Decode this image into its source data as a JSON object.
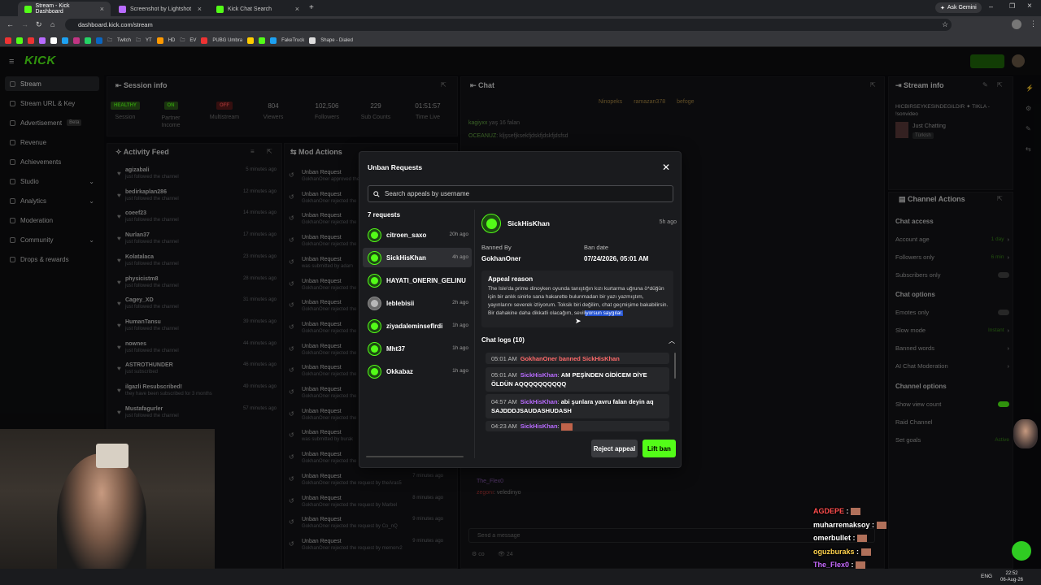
{
  "browser": {
    "tabs": [
      {
        "label": "Stream - Kick Dashboard",
        "active": true
      },
      {
        "label": "Screenshot by Lightshot",
        "active": false
      },
      {
        "label": "Kick Chat Search",
        "active": false
      }
    ],
    "ask_gemini": "Ask Gemini",
    "url": "dashboard.kick.com/stream",
    "bookmarks": [
      "Twitch",
      "YT",
      "HD",
      "EV",
      "PUBG Umbra",
      "FakeTruck",
      "Shape - Dialed"
    ]
  },
  "app": {
    "logo": "KICK",
    "sidebar": [
      {
        "label": "Stream",
        "active": true
      },
      {
        "label": "Stream URL & Key"
      },
      {
        "label": "Advertisement",
        "badge": "Beta"
      },
      {
        "label": "Revenue"
      },
      {
        "label": "Achievements"
      },
      {
        "label": "Studio"
      },
      {
        "label": "Analytics"
      },
      {
        "label": "Moderation"
      },
      {
        "label": "Community"
      },
      {
        "label": "Drops & rewards"
      }
    ],
    "session_info": {
      "title": "Session info",
      "stats": [
        {
          "value": "HEALTHY",
          "label": "Session"
        },
        {
          "value": "ON",
          "label": "Partner Income"
        },
        {
          "value": "OFF",
          "label": "Multistream"
        },
        {
          "value": "804",
          "label": "Viewers"
        },
        {
          "value": "102,506",
          "label": "Followers"
        },
        {
          "value": "229",
          "label": "Sub Counts"
        },
        {
          "value": "01:51:57",
          "label": "Time Live"
        }
      ]
    },
    "activity_feed": {
      "title": "Activity Feed",
      "items": [
        {
          "name": "agizabali",
          "sub": "just followed the channel",
          "time": "5 minutes ago"
        },
        {
          "name": "bedirkaplan286",
          "sub": "just followed the channel",
          "time": "12 minutes ago"
        },
        {
          "name": "coeef23",
          "sub": "just followed the channel",
          "time": "14 minutes ago"
        },
        {
          "name": "Nurlan37",
          "sub": "just followed the channel",
          "time": "17 minutes ago"
        },
        {
          "name": "Kolatalaca",
          "sub": "just followed the channel",
          "time": "23 minutes ago"
        },
        {
          "name": "physicistm8",
          "sub": "just followed the channel",
          "time": "28 minutes ago"
        },
        {
          "name": "Cagey_XD",
          "sub": "just followed the channel",
          "time": "31 minutes ago"
        },
        {
          "name": "HumanTansu",
          "sub": "just followed the channel",
          "time": "39 minutes ago"
        },
        {
          "name": "nownes",
          "sub": "just followed the channel",
          "time": "44 minutes ago"
        },
        {
          "name": "ASTROTHUNDER",
          "sub": "just subscribed",
          "time": "46 minutes ago"
        },
        {
          "name": "ilgazli Resubscribed!",
          "sub": "they have been subscribed for 3 months",
          "time": "49 minutes ago"
        },
        {
          "name": "Mustafagurler",
          "sub": "just followed the channel",
          "time": "57 minutes ago"
        }
      ]
    },
    "mod_actions": {
      "title": "Mod Actions",
      "items": [
        {
          "title": "Unban Request",
          "sub": "GokhanOner approved the"
        },
        {
          "title": "Unban Request",
          "sub": "GokhanOner rejected the"
        },
        {
          "title": "Unban Request",
          "sub": "GokhanOner rejected the"
        },
        {
          "title": "Unban Request",
          "sub": "GokhanOner rejected the"
        },
        {
          "title": "Unban Request",
          "sub": "was submitted by adam"
        },
        {
          "title": "Unban Request",
          "sub": "GokhanOner rejected the"
        },
        {
          "title": "Unban Request",
          "sub": "GokhanOner rejected the"
        },
        {
          "title": "Unban Request",
          "sub": "GokhanOner rejected the"
        },
        {
          "title": "Unban Request",
          "sub": "GokhanOner rejected the"
        },
        {
          "title": "Unban Request",
          "sub": "GokhanOner rejected the"
        },
        {
          "title": "Unban Request",
          "sub": "GokhanOner rejected the"
        },
        {
          "title": "Unban Request",
          "sub": "GokhanOner rejected the"
        },
        {
          "title": "Unban Request",
          "sub": "was submitted by burak"
        },
        {
          "title": "Unban Request",
          "sub": "GokhanOner rejected the"
        },
        {
          "title": "Unban Request",
          "sub": "GokhanOner rejected the request by theAras5",
          "time": "7 minutes ago"
        },
        {
          "title": "Unban Request",
          "sub": "GokhanOner rejected the request by Marbel",
          "time": "8 minutes ago"
        },
        {
          "title": "Unban Request",
          "sub": "GokhanOner rejected the request by Co_nQ",
          "time": "9 minutes ago"
        },
        {
          "title": "Unban Request",
          "sub": "GokhanOner rejected the request by memorv2",
          "time": "9 minutes ago"
        }
      ]
    },
    "chat": {
      "title": "Chat",
      "pinned": [
        "Ninopeks",
        "ramazan378",
        "befoge"
      ],
      "lines": [
        {
          "user": "kagiyxx",
          "msg": "yaş 16 falan"
        },
        {
          "user": "OCEANUZ",
          "msg": "kljşsefjksekfjdskfjdskfjdsfsd"
        },
        {
          "user": "AGDEPE",
          "msg": ""
        },
        {
          "user": "The_Flex0",
          "msg": ""
        },
        {
          "user": "zegonı",
          "msg": "veledinyo"
        }
      ],
      "input_placeholder": "Send a message",
      "viewer_count": "24"
    },
    "stream_info": {
      "title": "Stream info",
      "stream_title": "HICBIRSEYKESINDEGILDIR ✦ TIKLA - !sonvideo",
      "category": "Just Chatting",
      "language": "Türkish"
    },
    "channel_actions": {
      "title": "Channel Actions",
      "sections": [
        {
          "heading": "Chat access",
          "items": [
            {
              "label": "Account age",
              "value": "1 day"
            },
            {
              "label": "Followers only",
              "value": "6 min"
            },
            {
              "label": "Subscribers only",
              "value": "toggle-off"
            }
          ]
        },
        {
          "heading": "Chat options",
          "items": [
            {
              "label": "Emotes only",
              "value": "toggle-off"
            },
            {
              "label": "Slow mode",
              "value": "Instant"
            },
            {
              "label": "Banned words",
              "value": ""
            },
            {
              "label": "AI Chat Moderation",
              "value": ""
            }
          ]
        },
        {
          "heading": "Channel options",
          "items": [
            {
              "label": "Show view count",
              "value": "toggle-on"
            },
            {
              "label": "Raid Channel",
              "value": ""
            },
            {
              "label": "Set goals",
              "value": "Active"
            }
          ]
        }
      ]
    }
  },
  "modal": {
    "title": "Unban Requests",
    "search_placeholder": "Search appeals by username",
    "count_label": "7 requests",
    "requests": [
      {
        "name": "citroen_saxo",
        "time": "20h ago",
        "avatar": "kick"
      },
      {
        "name": "SickHisKhan",
        "time": "4h ago",
        "avatar": "kick",
        "selected": true
      },
      {
        "name": "HAYATI_ONERIN_GELINU",
        "time": "",
        "avatar": "kick"
      },
      {
        "name": "leblebisii",
        "time": "2h ago",
        "avatar": "photo"
      },
      {
        "name": "ziyadaleminseflrdir",
        "time": "1h ago",
        "avatar": "kick"
      },
      {
        "name": "Mht37",
        "time": "1h ago",
        "avatar": "kick"
      },
      {
        "name": "Okkabaz",
        "time": "1h ago",
        "avatar": "kick"
      }
    ],
    "detail": {
      "name": "SickHisKhan",
      "time": "5h ago",
      "banned_by_label": "Banned By",
      "banned_by": "GokhanOner",
      "ban_date_label": "Ban date",
      "ban_date": "07/24/2026, 05:01 AM",
      "appeal_title": "Appeal reason",
      "appeal_text": "The Isle'da prime dinoyken oyunda tanıştığın kızı kurtarma uğruna ö*düğün için bir anlık sinirle sana hakarette bulunmadan bir yazı yazmıştım, yayınlarını severek izliyorum. Toksik biri değilim, chat geçmişime bakabilirsin. Bir dahakine daha dikkatli olacağım, sevil",
      "appeal_highlight": "iyorsun saygılar.",
      "chat_logs_title": "Chat logs (10)",
      "logs": [
        {
          "time": "05:01 AM",
          "system": "GokhanOner banned SickHisKhan"
        },
        {
          "time": "05:01 AM",
          "user": "SickHisKhan",
          "msg": "AM PEŞİNDEN GİDİCEM DİYE ÖLDÜN AQQQQQQQQQQ"
        },
        {
          "time": "04:57 AM",
          "user": "SickHisKhan",
          "msg": "abi şunlara yavru falan deyin aq SAJDDDJSAUDASHUDASH"
        },
        {
          "time": "04:23 AM",
          "user": "SickHisKhan",
          "msg": ""
        }
      ],
      "reject_label": "Reject appeal",
      "lift_label": "Lift ban"
    }
  },
  "stream_overlay_chat": [
    {
      "user": "AGDEPE",
      "color": "#ff4d4d"
    },
    {
      "user": "muharremaksoy",
      "color": "#ffffff"
    },
    {
      "user": "omerbullet",
      "color": "#ffffff"
    },
    {
      "user": "oguzburaks",
      "color": "#ffd24d"
    },
    {
      "user": "The_Flex0",
      "color": "#c86bff"
    },
    {
      "user": "zegonı",
      "color": "#ff4d4d",
      "msg": "veledinyo"
    }
  ],
  "taskbar": {
    "lang": "ENG",
    "time": "22:52",
    "date": "06-Aug-26"
  },
  "colors": {
    "accent": "#53fc18",
    "username": "#b86bff",
    "system": "#ff6a6a"
  }
}
